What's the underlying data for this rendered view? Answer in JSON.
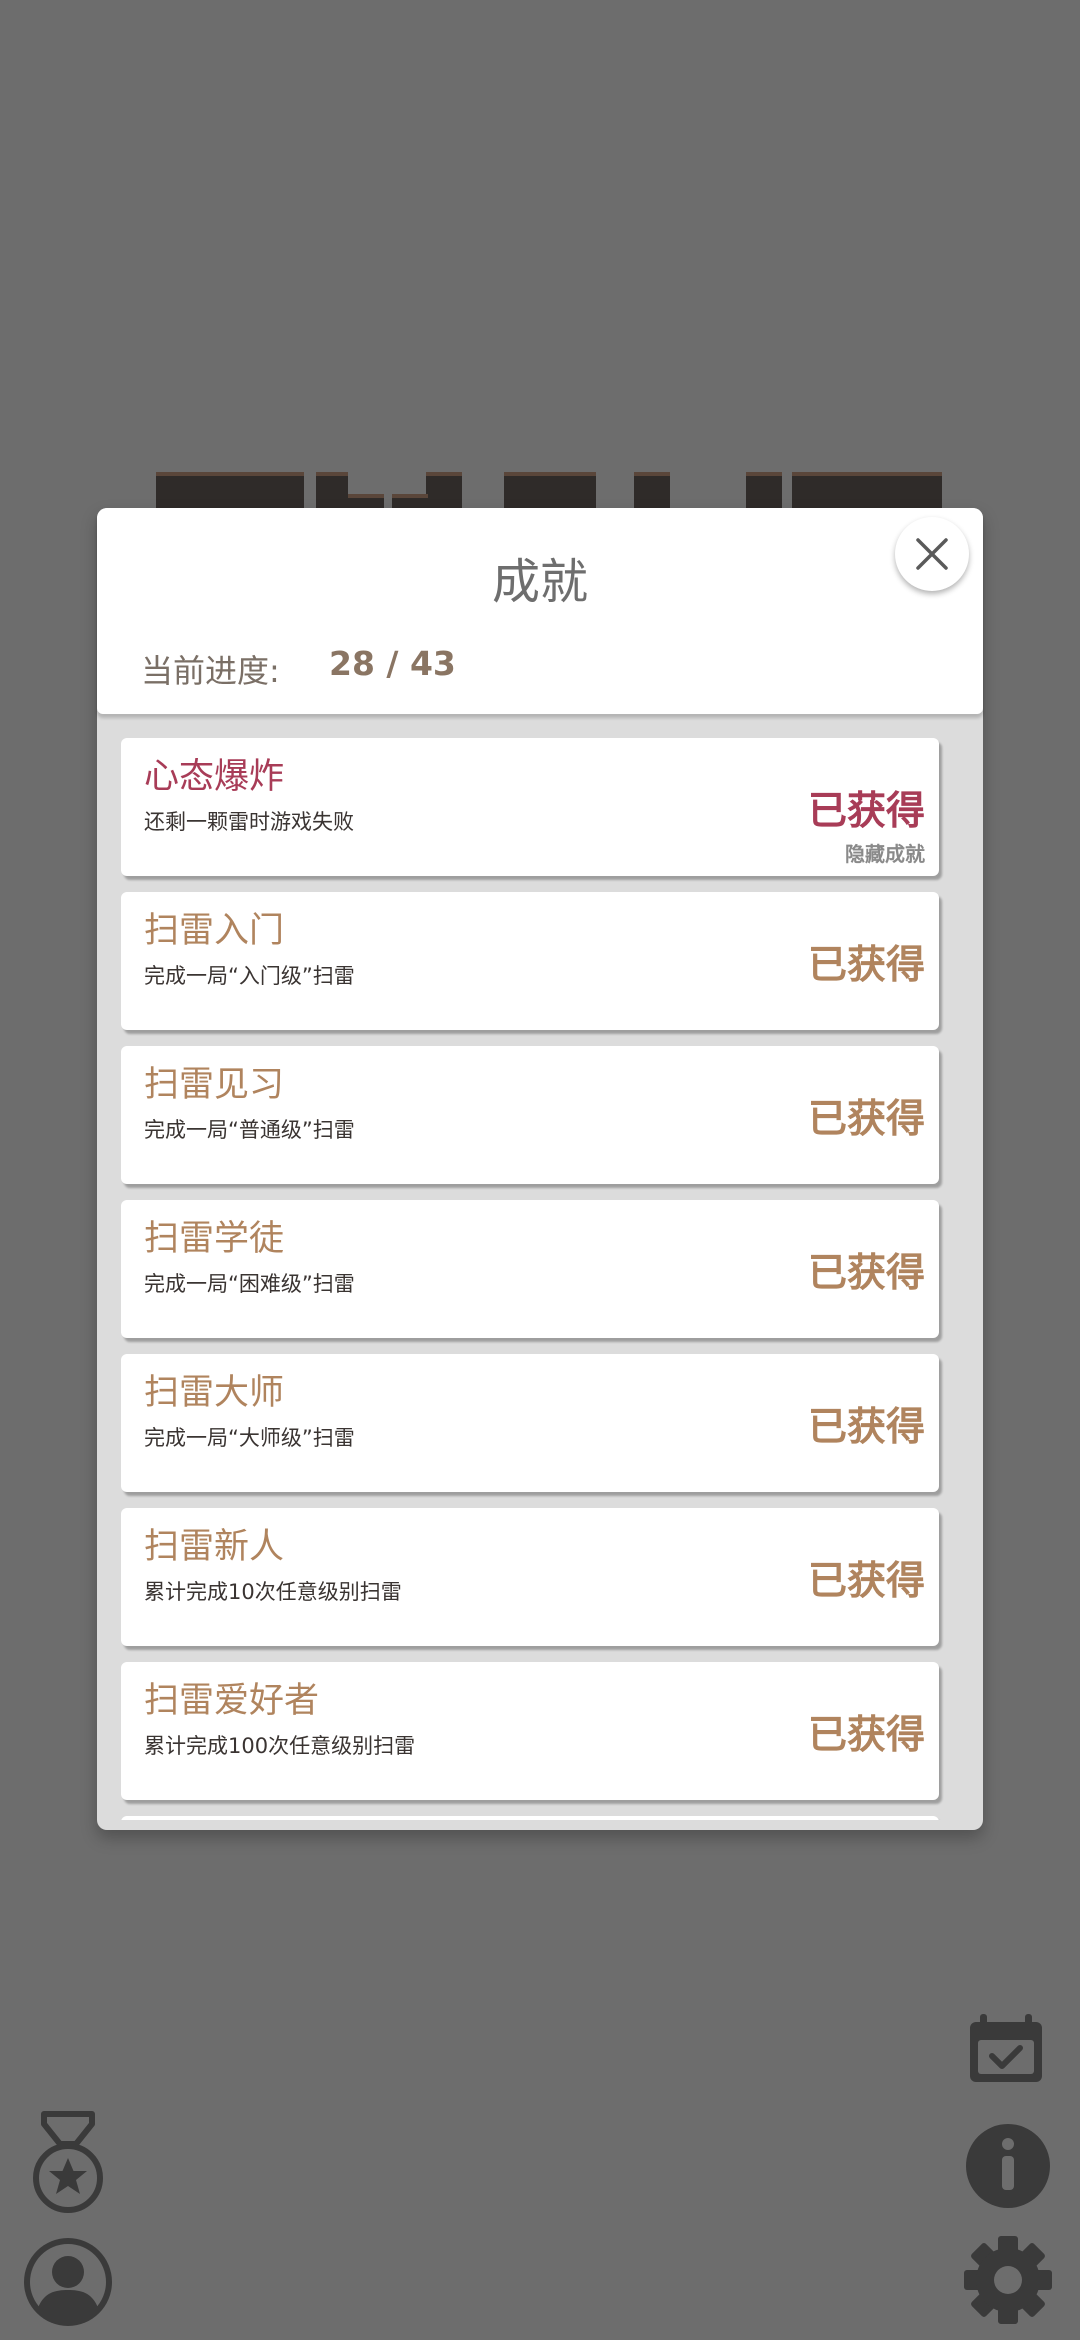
{
  "modal": {
    "title": "成就",
    "progress_label": "当前进度:",
    "progress_value": "28 / 43"
  },
  "achievements": [
    {
      "name": "心态爆炸",
      "description": "还剩一颗雷时游戏失败",
      "status": "已获得",
      "tag": "隐藏成就",
      "hidden": true
    },
    {
      "name": "扫雷入门",
      "description": "完成一局“入门级”扫雷",
      "status": "已获得"
    },
    {
      "name": "扫雷见习",
      "description": "完成一局“普通级”扫雷",
      "status": "已获得"
    },
    {
      "name": "扫雷学徒",
      "description": "完成一局“困难级”扫雷",
      "status": "已获得"
    },
    {
      "name": "扫雷大师",
      "description": "完成一局“大师级”扫雷",
      "status": "已获得"
    },
    {
      "name": "扫雷新人",
      "description": "累计完成10次任意级别扫雷",
      "status": "已获得"
    },
    {
      "name": "扫雷爱好者",
      "description": "累计完成100次任意级别扫雷",
      "status": "已获得"
    }
  ],
  "colors": {
    "background": "#6d6d6d",
    "earned": "#b0845e",
    "hidden_achievement": "#a83c57",
    "icon_dark": "#3a3a3a"
  },
  "icons": {
    "close": "close-icon",
    "calendar": "calendar-check-icon",
    "info": "info-icon",
    "medal": "medal-star-icon",
    "profile": "user-profile-icon",
    "settings": "gear-icon"
  }
}
